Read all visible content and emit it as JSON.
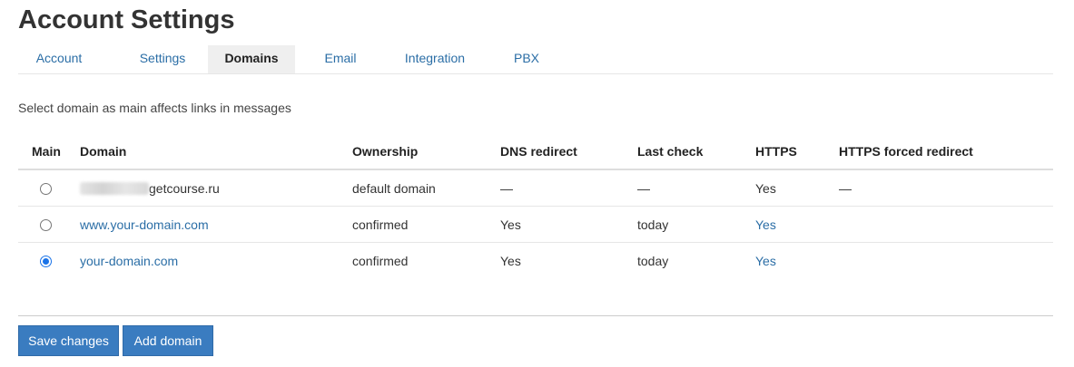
{
  "page": {
    "title": "Account Settings"
  },
  "tabs": [
    {
      "label": "Account"
    },
    {
      "label": "Settings"
    },
    {
      "label": "Domains"
    },
    {
      "label": "Email"
    },
    {
      "label": "Integration"
    },
    {
      "label": "PBX"
    }
  ],
  "active_tab": "Domains",
  "hint": "Select domain as main affects links in messages",
  "table": {
    "headers": {
      "main": "Main",
      "domain": "Domain",
      "ownership": "Ownership",
      "dns_redirect": "DNS redirect",
      "last_check": "Last check",
      "https": "HTTPS",
      "https_forced_redirect": "HTTPS forced redirect"
    },
    "rows": [
      {
        "selected": false,
        "domain": "getcourse.ru",
        "domain_prefix_redacted": true,
        "ownership": "default domain",
        "dns_redirect": "—",
        "last_check": "—",
        "https": "Yes",
        "https_forced_redirect": "—"
      },
      {
        "selected": false,
        "domain": "www.your-domain.com",
        "ownership": "confirmed",
        "dns_redirect": "Yes",
        "last_check": "today",
        "https": "Yes",
        "https_forced_redirect": ""
      },
      {
        "selected": true,
        "domain": "your-domain.com",
        "ownership": "confirmed",
        "dns_redirect": "Yes",
        "last_check": "today",
        "https": "Yes",
        "https_forced_redirect": ""
      }
    ]
  },
  "buttons": {
    "save": "Save changes",
    "add_domain": "Add domain"
  },
  "colors": {
    "accent": "#3a7cc0",
    "link": "#2b6ea6",
    "active_tab_bg": "#efefef"
  }
}
